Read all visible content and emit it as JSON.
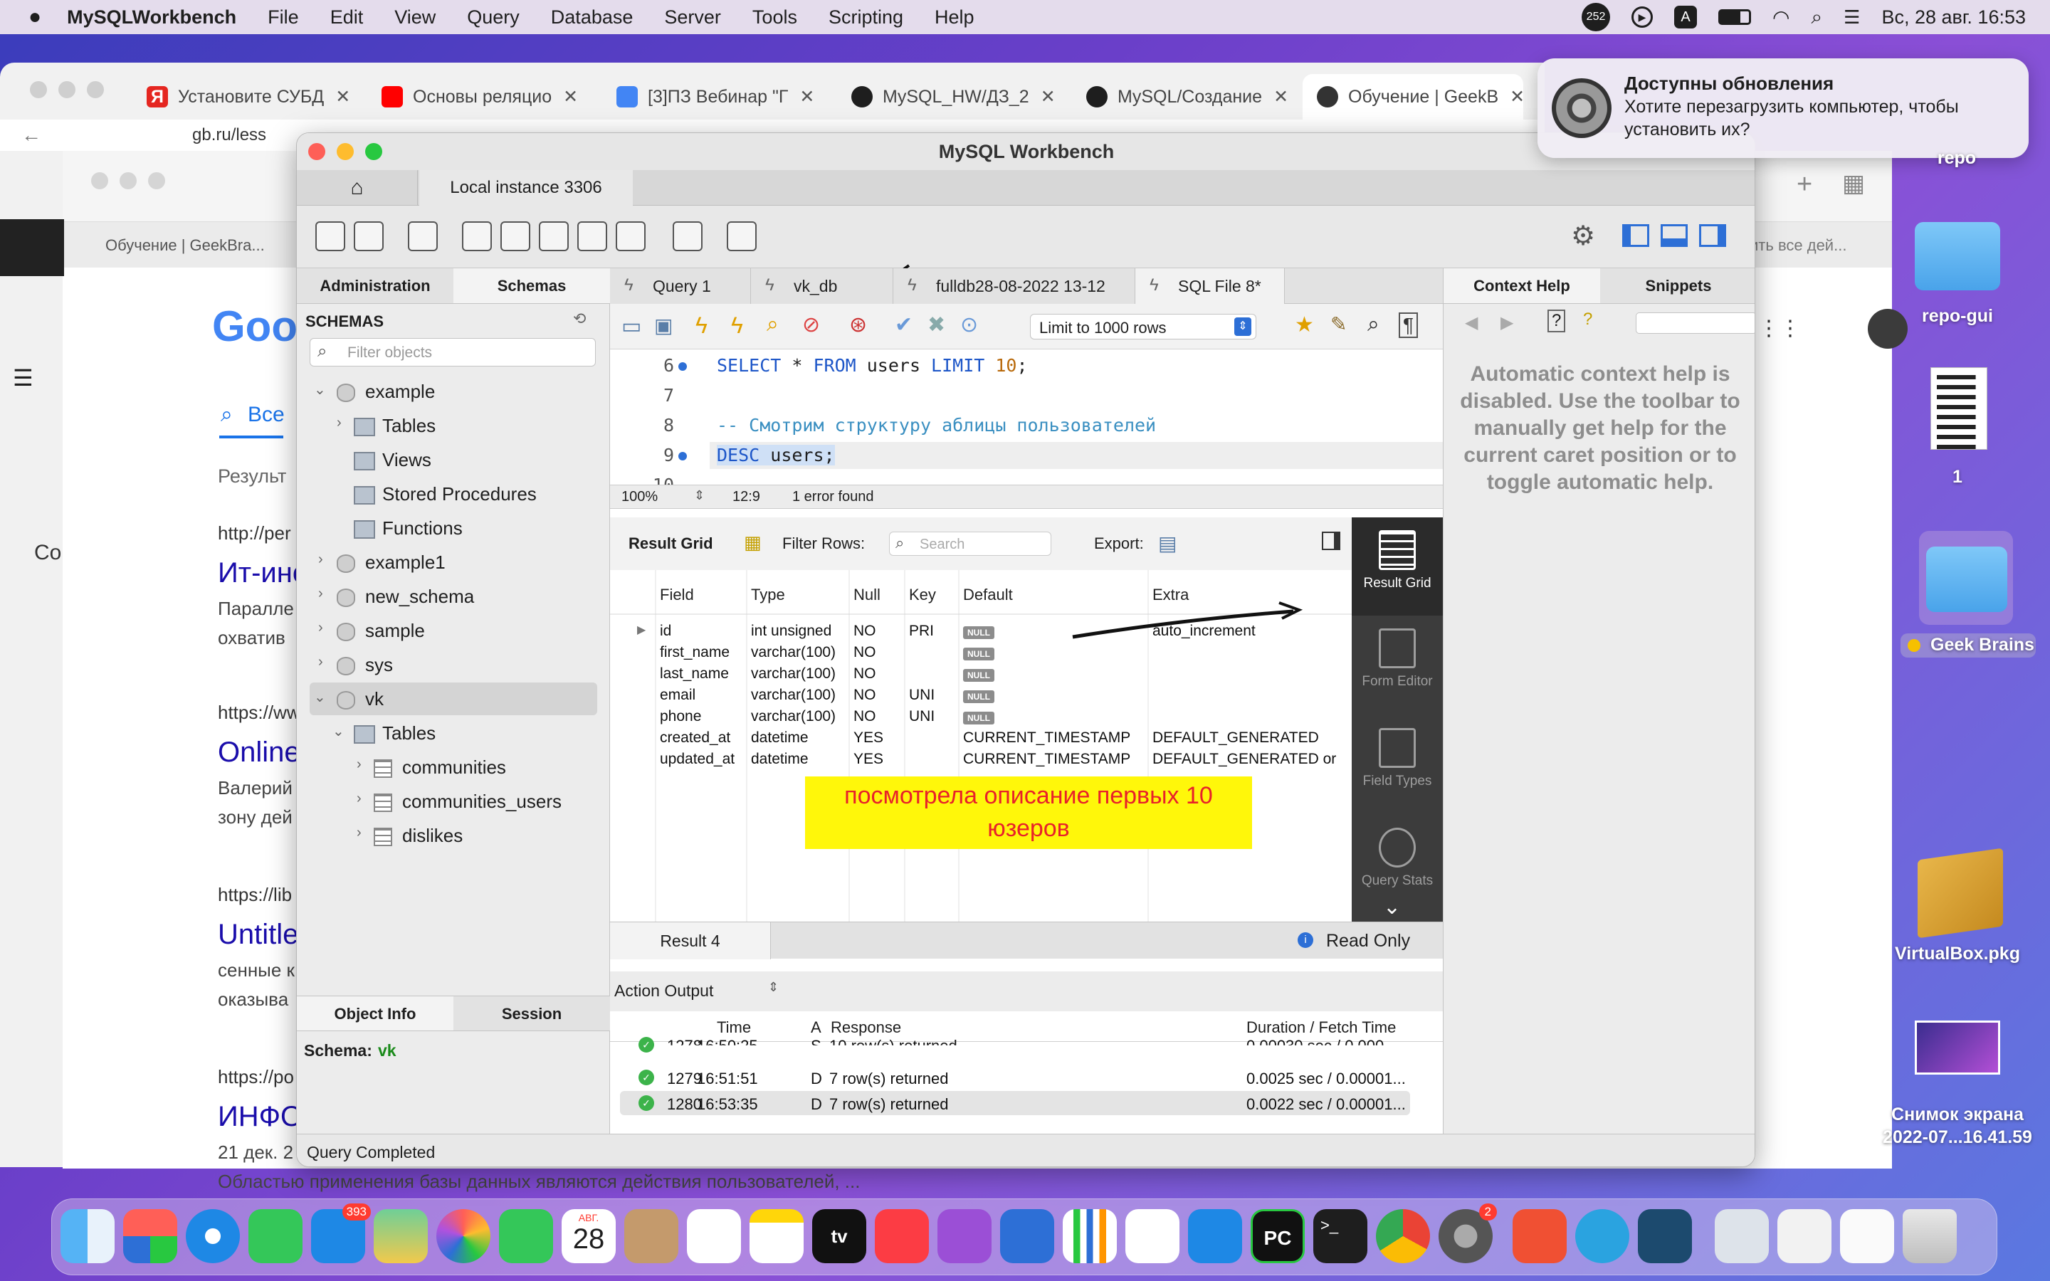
{
  "menubar": {
    "app": "MySQLWorkbench",
    "items": [
      "File",
      "Edit",
      "View",
      "Query",
      "Database",
      "Server",
      "Tools",
      "Scripting",
      "Help"
    ],
    "badge": "252",
    "input_source": "A",
    "datetime": "Вс, 28 авг.  16:53"
  },
  "browser": {
    "tabs": [
      {
        "label": "Установите СУБД",
        "color": "#e52620"
      },
      {
        "label": "Основы реляцио",
        "color": "#ff0000"
      },
      {
        "label": "[3]ПЗ Вебинар \"Г",
        "color": "#4285f4"
      },
      {
        "label": "MySQL_HW/ДЗ_2",
        "color": "#1e1e1e"
      },
      {
        "label": "MySQL/Создание",
        "color": "#1e1e1e"
      },
      {
        "label": "Обучение | GeekB",
        "color": "#333333"
      }
    ],
    "address": "gb.ru/less",
    "bg_tab": "Обучение | GeekBra...",
    "bg_right": "ить все дей...",
    "repo_label": "repo"
  },
  "google": {
    "logo": "Goo",
    "tab_all": "Все",
    "results_label": "Результ",
    "side_letter": "Со",
    "results": [
      {
        "url": "http://per",
        "title": "Ит-ино",
        "snippet1": "Паралле",
        "snippet2": "охватив"
      },
      {
        "url": "https://ww",
        "title": "Online",
        "snippet1": "Валерий",
        "snippet2": "зону дей"
      },
      {
        "url": "https://lib",
        "title": "Untitle",
        "snippet1": "сенные к",
        "snippet2": "оказыва"
      },
      {
        "url": "https://po",
        "title": "ИНФО",
        "snippet1": "21 дек. 2",
        "snippet2": "Областью применения базы данных являются действия пользователей, ..."
      }
    ]
  },
  "workbench": {
    "title": "MySQL Workbench",
    "instance_tab": "Local instance 3306",
    "sidebar_tabs": [
      "Administration",
      "Schemas"
    ],
    "schemas_label": "SCHEMAS",
    "filter_placeholder": "Filter objects",
    "tree": [
      "example",
      "Tables",
      "Views",
      "Stored Procedures",
      "Functions",
      "example1",
      "new_schema",
      "sample",
      "sys",
      "vk",
      "Tables",
      "communities",
      "communities_users",
      "dislikes"
    ],
    "bottom_tabs": [
      "Object Info",
      "Session"
    ],
    "schema_info_label": "Schema:",
    "schema_info_value": "vk",
    "query_tabs": [
      "Query 1",
      "vk_db",
      "fulldb28-08-2022 13-12",
      "SQL File 8*"
    ],
    "limit_select": "Limit to 1000 rows",
    "code_lines": [
      {
        "n": "6",
        "dot": true
      },
      {
        "n": "7",
        "dot": false
      },
      {
        "n": "8",
        "dot": false
      },
      {
        "n": "9",
        "dot": true
      },
      {
        "n": "10",
        "dot": false
      }
    ],
    "code": {
      "l6_kw1": "SELECT",
      "l6_mid": " * ",
      "l6_kw2": "FROM",
      "l6_rest": " users ",
      "l6_kw3": "LIMIT",
      "l6_num": " 10",
      "l6_end": ";",
      "l8": "-- Смотрим структуру аблицы пользователей",
      "l9_kw": "DESC",
      "l9_rest": " users;"
    },
    "editor_status": {
      "zoom": "100%",
      "caret": "12:9",
      "errors": "1 error found"
    },
    "result_toolbar": {
      "grid": "Result Grid",
      "filter": "Filter Rows:",
      "search_placeholder": "Search",
      "export": "Export:"
    },
    "columns": [
      "Field",
      "Type",
      "Null",
      "Key",
      "Default",
      "Extra"
    ],
    "rows": [
      [
        "id",
        "int unsigned",
        "NO",
        "PRI",
        "NULL",
        "auto_increment"
      ],
      [
        "first_name",
        "varchar(100)",
        "NO",
        "",
        "NULL",
        ""
      ],
      [
        "last_name",
        "varchar(100)",
        "NO",
        "",
        "NULL",
        ""
      ],
      [
        "email",
        "varchar(100)",
        "NO",
        "UNI",
        "NULL",
        ""
      ],
      [
        "phone",
        "varchar(100)",
        "NO",
        "UNI",
        "NULL",
        ""
      ],
      [
        "created_at",
        "datetime",
        "YES",
        "",
        "CURRENT_TIMESTAMP",
        "DEFAULT_GENERATED"
      ],
      [
        "updated_at",
        "datetime",
        "YES",
        "",
        "CURRENT_TIMESTAMP",
        "DEFAULT_GENERATED or"
      ]
    ],
    "annotation": "посмотрела описание первых 10 юзеров",
    "right_panel": [
      "Result Grid",
      "Form Editor",
      "Field Types",
      "Query Stats"
    ],
    "result_tab": "Result 4",
    "read_only": "Read Only",
    "action_output": "Action Output",
    "output_columns": [
      "Time",
      "A",
      "Response",
      "Duration / Fetch Time"
    ],
    "output_rows": [
      {
        "n": "1278",
        "time": "16:50:25",
        "a": "S",
        "resp": "10 row(s) returned",
        "dur": "0.00030 sec / 0.000..."
      },
      {
        "n": "1279",
        "time": "16:51:51",
        "a": "D",
        "resp": "7 row(s) returned",
        "dur": "0.0025 sec / 0.00001..."
      },
      {
        "n": "1280",
        "time": "16:53:35",
        "a": "D",
        "resp": "7 row(s) returned",
        "dur": "0.0022 sec / 0.00001..."
      }
    ],
    "context_tabs": [
      "Context Help",
      "Snippets"
    ],
    "context_text": "Automatic context help is disabled. Use the toolbar to manually get help for the current caret position or to toggle automatic help.",
    "status": "Query Completed"
  },
  "notification": {
    "title": "Доступны обновления",
    "body": "Хотите перезагрузить компьютер, чтобы установить их?"
  },
  "desktop": [
    "repo-gui",
    "1",
    "Geek Brains",
    "VirtualBox.pkg",
    "Снимок экрана",
    "2022-07...16.41.59"
  ],
  "dock": {
    "mail_badge": "393",
    "calendar_month": "АВГ.",
    "calendar_day": "28",
    "settings_badge": "2",
    "tv": "tv",
    "pc": "PC"
  }
}
